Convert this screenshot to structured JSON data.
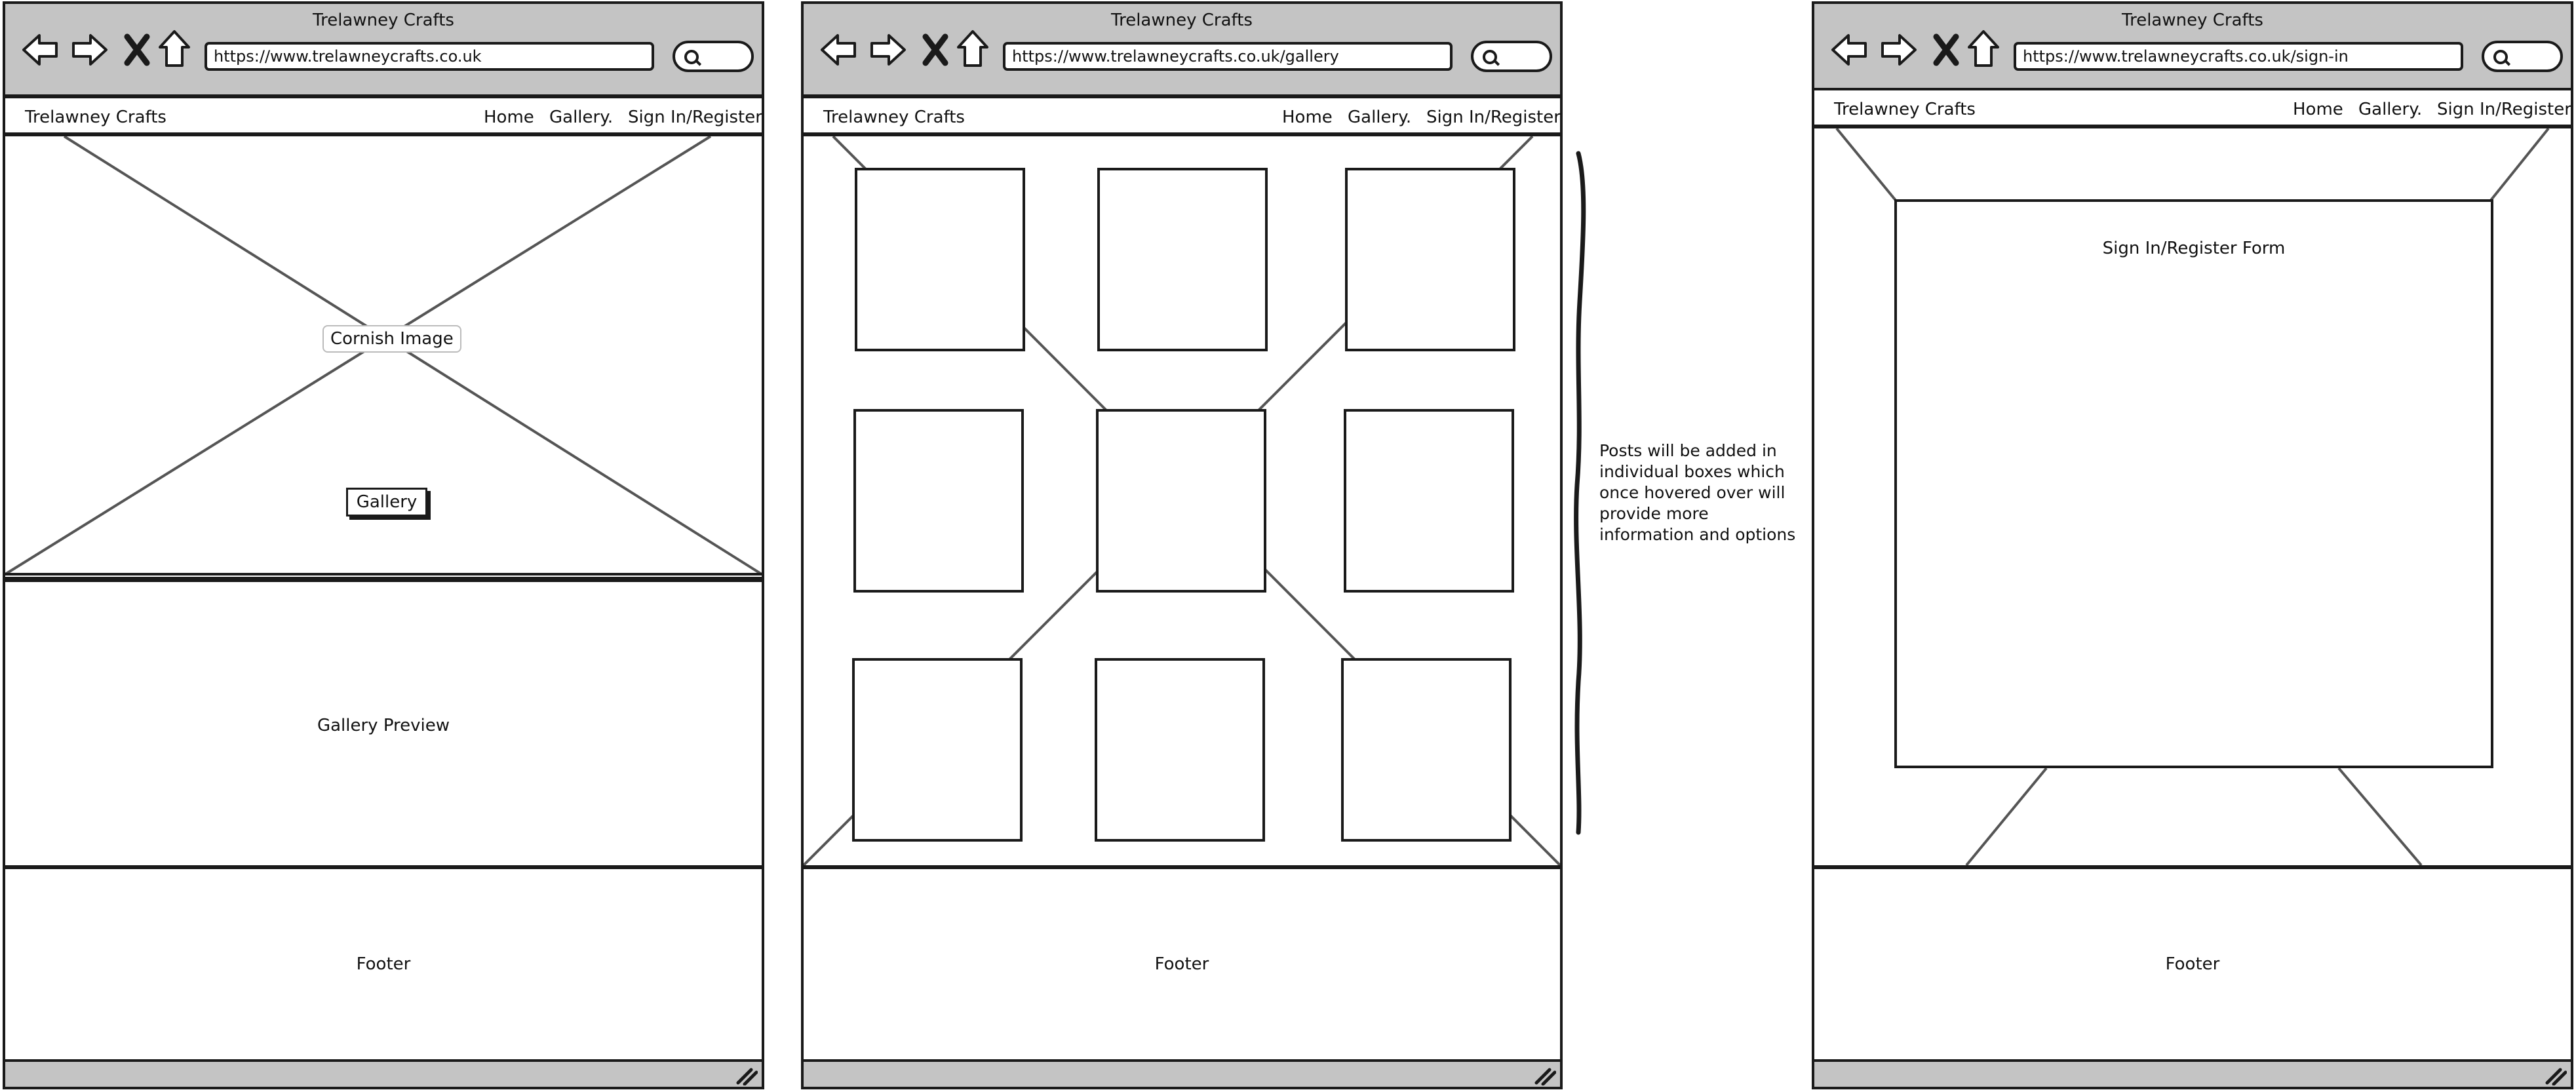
{
  "site_name": "Trelawney Crafts",
  "nav": {
    "home": "Home",
    "gallery": "Gallery.",
    "signin": "Sign In/Register"
  },
  "icons": [
    "back-arrow-icon",
    "forward-arrow-icon",
    "close-icon",
    "home-icon",
    "search-icon",
    "resize-grip-icon"
  ],
  "wireframes": [
    {
      "url": "https://www.trelawneycrafts.co.uk",
      "hero_label": "Cornish Image",
      "hero_button": "Gallery",
      "preview_label": "Gallery Preview",
      "footer": "Footer"
    },
    {
      "url": "https://www.trelawneycrafts.co.uk/gallery",
      "footer": "Footer"
    },
    {
      "url": "https://www.trelawneycrafts.co.uk/sign-in",
      "form_label": "Sign In/Register Form",
      "footer": "Footer"
    }
  ],
  "annotation": "Posts will be added in individual boxes which once hovered over will provide more information and options",
  "colors": {
    "chrome": "#c4c4c4",
    "stroke": "#1a1a1a",
    "diagonal": "#555555"
  }
}
